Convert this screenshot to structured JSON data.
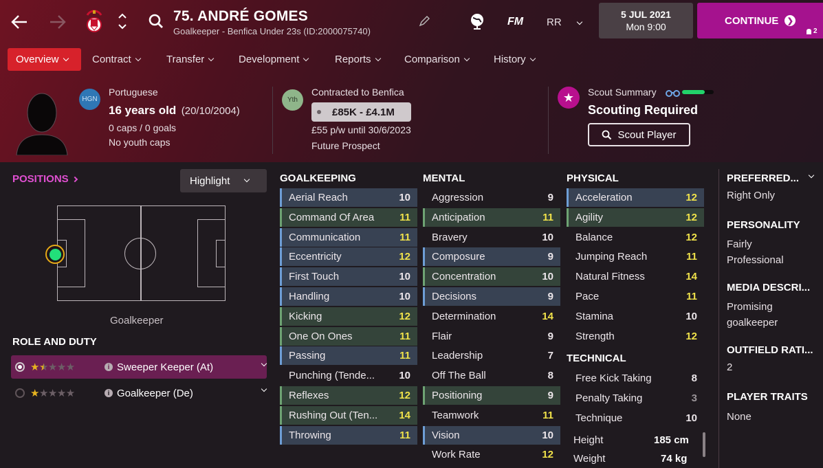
{
  "header": {
    "title": "75. ANDRÉ GOMES",
    "subtitle": "Goalkeeper - Benfica Under 23s (ID:2000075740)",
    "fm_label": "FM",
    "rr_label": "RR",
    "date": "5 JUL 2021",
    "time": "Mon 9:00",
    "continue_label": "CONTINUE",
    "notif_count": "2"
  },
  "nav": [
    "Overview",
    "Contract",
    "Transfer",
    "Development",
    "Reports",
    "Comparison",
    "History"
  ],
  "bio": {
    "nation_badge": "HGN",
    "nationality": "Portuguese",
    "age": "16 years old",
    "dob": "(20/10/2004)",
    "caps": "0 caps / 0 goals",
    "youth": "No youth caps"
  },
  "contract": {
    "badge": "Yth",
    "title": "Contracted to Benfica",
    "value": "£85K - £4.1M",
    "wage": "£55 p/w until 30/6/2023",
    "status": "Future Prospect"
  },
  "scout": {
    "label": "Scout Summary",
    "status": "Scouting Required",
    "button": "Scout Player"
  },
  "positions": {
    "title": "POSITIONS",
    "highlight": "Highlight",
    "position_name": "Goalkeeper"
  },
  "roles": {
    "title": "ROLE AND DUTY",
    "items": [
      {
        "name": "Sweeper Keeper (At)",
        "stars": 1.5
      },
      {
        "name": "Goalkeeper (De)",
        "stars": 1
      }
    ]
  },
  "attributes": {
    "goalkeeping": {
      "title": "GOALKEEPING",
      "rows": [
        [
          "Aerial Reach",
          "10"
        ],
        [
          "Command Of Area",
          "11"
        ],
        [
          "Communication",
          "11"
        ],
        [
          "Eccentricity",
          "12"
        ],
        [
          "First Touch",
          "10"
        ],
        [
          "Handling",
          "10"
        ],
        [
          "Kicking",
          "12"
        ],
        [
          "One On Ones",
          "11"
        ],
        [
          "Passing",
          "11"
        ],
        [
          "Punching (Tende...",
          "10"
        ],
        [
          "Reflexes",
          "12"
        ],
        [
          "Rushing Out (Ten...",
          "14"
        ],
        [
          "Throwing",
          "11"
        ]
      ]
    },
    "mental": {
      "title": "MENTAL",
      "rows": [
        [
          "Aggression",
          "9"
        ],
        [
          "Anticipation",
          "11"
        ],
        [
          "Bravery",
          "10"
        ],
        [
          "Composure",
          "9"
        ],
        [
          "Concentration",
          "10"
        ],
        [
          "Decisions",
          "9"
        ],
        [
          "Determination",
          "14"
        ],
        [
          "Flair",
          "9"
        ],
        [
          "Leadership",
          "7"
        ],
        [
          "Off The Ball",
          "8"
        ],
        [
          "Positioning",
          "9"
        ],
        [
          "Teamwork",
          "11"
        ],
        [
          "Vision",
          "10"
        ],
        [
          "Work Rate",
          "12"
        ]
      ]
    },
    "physical": {
      "title": "PHYSICAL",
      "rows": [
        [
          "Acceleration",
          "12"
        ],
        [
          "Agility",
          "12"
        ],
        [
          "Balance",
          "12"
        ],
        [
          "Jumping Reach",
          "11"
        ],
        [
          "Natural Fitness",
          "14"
        ],
        [
          "Pace",
          "11"
        ],
        [
          "Stamina",
          "10"
        ],
        [
          "Strength",
          "12"
        ]
      ]
    },
    "technical": {
      "title": "TECHNICAL",
      "rows": [
        [
          "Free Kick Taking",
          "8"
        ],
        [
          "Penalty Taking",
          "3"
        ],
        [
          "Technique",
          "10"
        ]
      ]
    },
    "height_label": "Height",
    "height": "185 cm",
    "weight_label": "Weight",
    "weight": "74 kg"
  },
  "right": {
    "preferred_title": "PREFERRED...",
    "preferred": "Right Only",
    "personality_title": "PERSONALITY",
    "personality": "Fairly Professional",
    "media_title": "MEDIA DESCRI...",
    "media": "Promising goalkeeper",
    "outfield_title": "OUTFIELD RATI...",
    "outfield": "2",
    "traits_title": "PLAYER TRAITS",
    "traits": "None"
  },
  "colors": {
    "accent": "#a5128e",
    "nav_active": "#d7222b",
    "highlight_yellow": "#f0e24a",
    "gk_dot": "#22e07a"
  }
}
